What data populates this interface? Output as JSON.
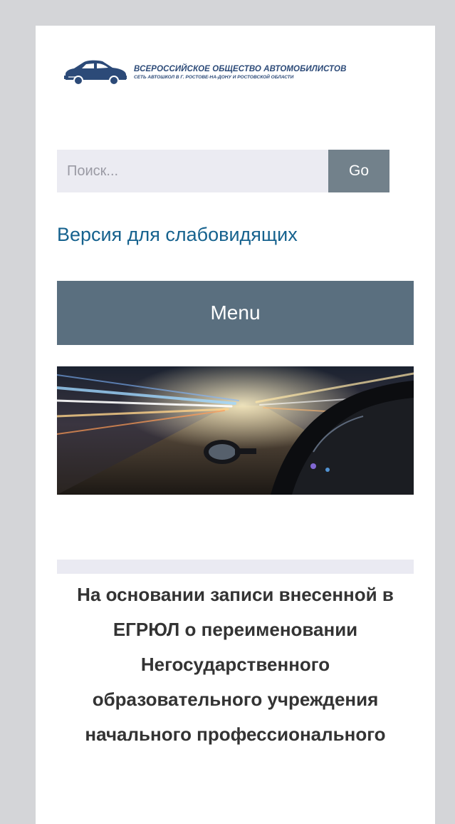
{
  "header": {
    "logo_line1": "ВСЕРОССИЙСКОЕ ОБЩЕСТВО АВТОМОБИЛИСТОВ",
    "logo_line2": "СЕТЬ АВТОШКОЛ В Г. РОСТОВЕ-НА-ДОНУ И РОСТОВСКОЙ ОБЛАСТИ",
    "logo_icon": "car-icon"
  },
  "search": {
    "placeholder": "Поиск...",
    "value": "",
    "button_label": "Go"
  },
  "accessibility_link": "Версия для слабовидящих",
  "menu": {
    "label": "Menu"
  },
  "hero": {
    "image": "night-road-car-mirror"
  },
  "content": {
    "notice": "На основании записи внесенной в ЕГРЮЛ о переименовании Негосударственного образовательного учреждения начального профессионального"
  },
  "colors": {
    "page_background": "#d4d5d8",
    "card_background": "#ffffff",
    "search_field": "#ebebf2",
    "search_button": "#72818b",
    "link": "#16628e",
    "menu_bar": "#5a6f7f",
    "logo": "#2c4a78",
    "text": "#333333"
  }
}
